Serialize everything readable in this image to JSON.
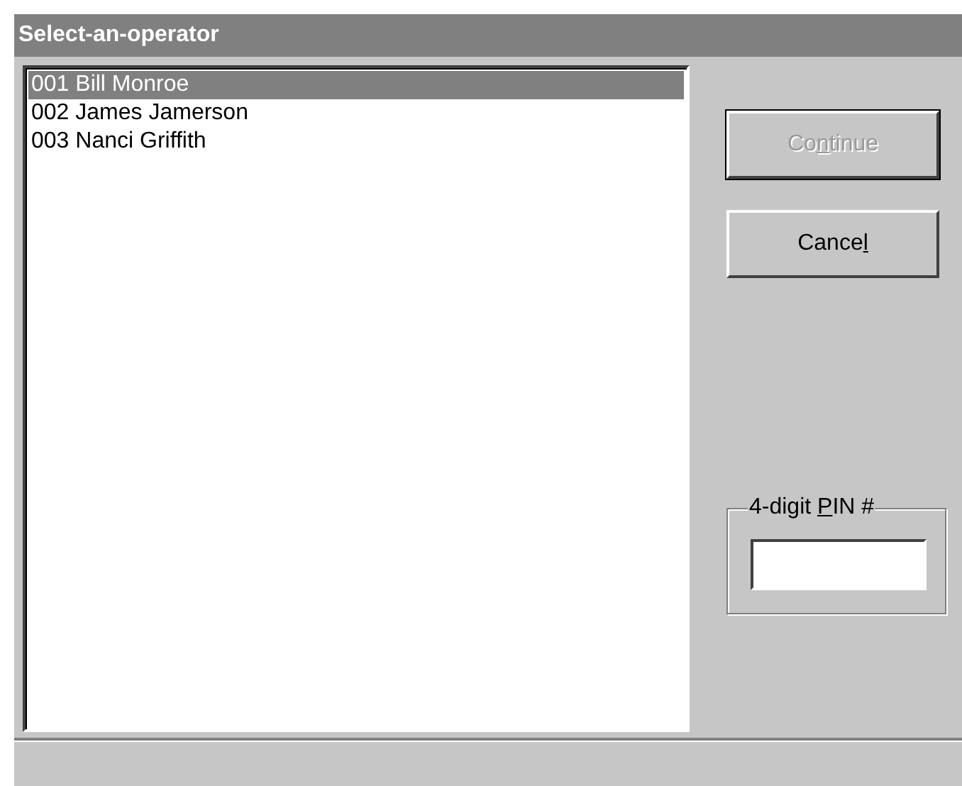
{
  "window": {
    "title": "Select-an-operator"
  },
  "operators": [
    {
      "label": "001 Bill Monroe",
      "selected": true
    },
    {
      "label": "002 James Jamerson",
      "selected": false
    },
    {
      "label": "003 Nanci Griffith",
      "selected": false
    }
  ],
  "buttons": [
    {
      "before": "Co",
      "key": "n",
      "after": "tinue",
      "disabled": true
    },
    {
      "before": "Cance",
      "key": "l",
      "disabled": false
    }
  ],
  "pin": {
    "before": "4-digit ",
    "key": "P",
    "after": "IN #"
  }
}
